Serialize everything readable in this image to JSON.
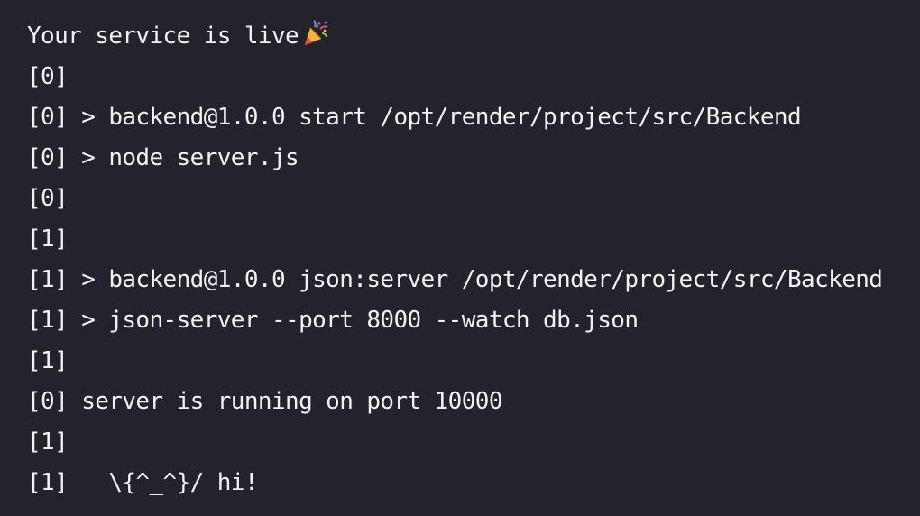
{
  "log": {
    "status_text": "Your service is live",
    "status_icon": "party-popper-icon",
    "lines": [
      "[0]",
      "[0] > backend@1.0.0 start /opt/render/project/src/Backend",
      "[0] > node server.js",
      "[0]",
      "[1]",
      "[1] > backend@1.0.0 json:server /opt/render/project/src/Backend",
      "[1] > json-server --port 8000 --watch db.json",
      "[1]",
      "[0] server is running on port 10000",
      "[1]",
      "[1]   \\{^_^}/ hi!"
    ]
  },
  "colors": {
    "background": "#22232d",
    "text": "#f2f2f4"
  }
}
